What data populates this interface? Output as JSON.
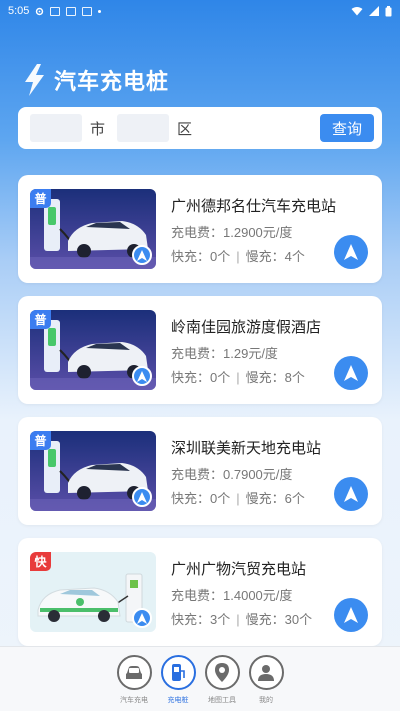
{
  "status_bar": {
    "time": "5:05"
  },
  "header": {
    "title": "汽车充电桩"
  },
  "search": {
    "city_value": "",
    "city_unit": "市",
    "district_value": "",
    "district_unit": "区",
    "query_label": "查询"
  },
  "stations": [
    {
      "type_badge": "普",
      "name": "广州德邦名仕汽车充电站",
      "fee_label": "充电费：",
      "fee_value": "1.2900元/度",
      "fast_label": "快充：",
      "fast_count": "0个",
      "slow_label": "慢充：",
      "slow_count": "4个"
    },
    {
      "type_badge": "普",
      "name": "岭南佳园旅游度假酒店",
      "fee_label": "充电费：",
      "fee_value": "1.29元/度",
      "fast_label": "快充：",
      "fast_count": "0个",
      "slow_label": "慢充：",
      "slow_count": "8个"
    },
    {
      "type_badge": "普",
      "name": "深圳联美新天地充电站",
      "fee_label": "充电费：",
      "fee_value": "0.7900元/度",
      "fast_label": "快充：",
      "fast_count": "0个",
      "slow_label": "慢充：",
      "slow_count": "6个"
    },
    {
      "type_badge": "快",
      "name": "广州广物汽贸充电站",
      "fee_label": "充电费：",
      "fee_value": "1.4000元/度",
      "fast_label": "快充：",
      "fast_count": "3个",
      "slow_label": "慢充：",
      "slow_count": "30个"
    }
  ],
  "bottom_nav": [
    {
      "label": "汽车充电",
      "icon": "car-icon"
    },
    {
      "label": "充电桩",
      "icon": "charger-icon"
    },
    {
      "label": "地图工具",
      "icon": "map-pin-icon"
    },
    {
      "label": "我的",
      "icon": "user-icon"
    }
  ],
  "colors": {
    "accent": "#3b8cf0",
    "slow_badge": "#3b7df0",
    "fast_badge": "#e83b3b",
    "active_tab": "#2a6fe0"
  }
}
